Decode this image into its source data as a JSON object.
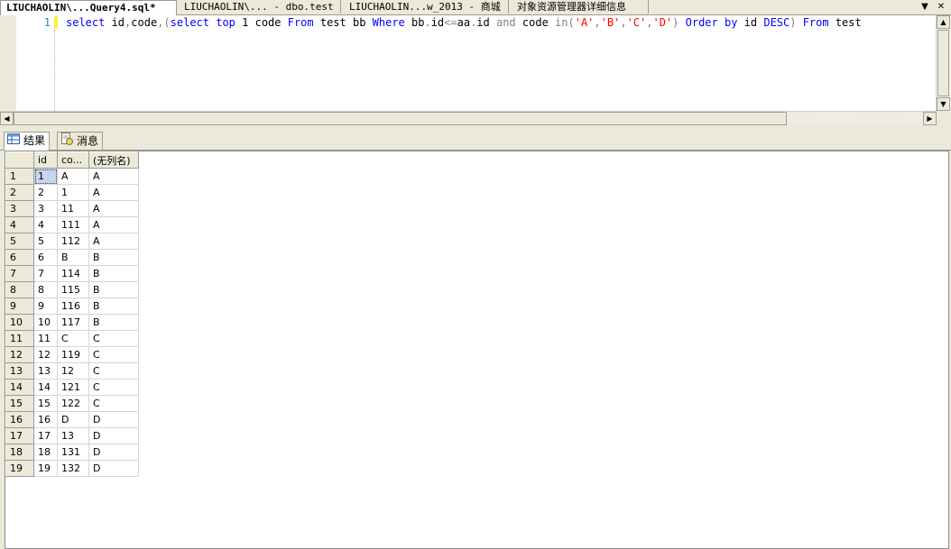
{
  "doc_tabs": [
    {
      "label": "LIUCHAOLIN\\...Query4.sql*",
      "active": true
    },
    {
      "label": "LIUCHAOLIN\\... - dbo.test",
      "active": false
    },
    {
      "label": "LIUCHAOLIN...w_2013 - 商城",
      "active": false
    },
    {
      "label": "对象资源管理器详细信息",
      "active": false
    }
  ],
  "tab_controls": {
    "dropdown": "▼",
    "close": "✕"
  },
  "editor": {
    "line_number": "1",
    "tokens": [
      {
        "t": "select",
        "c": "kw"
      },
      {
        "t": " id",
        "c": "id"
      },
      {
        "t": ",",
        "c": "gr"
      },
      {
        "t": "code",
        "c": "id"
      },
      {
        "t": ",(",
        "c": "gr"
      },
      {
        "t": "select",
        "c": "kw"
      },
      {
        "t": " ",
        "c": "id"
      },
      {
        "t": "top",
        "c": "kw"
      },
      {
        "t": " 1 code ",
        "c": "id"
      },
      {
        "t": "From",
        "c": "kw"
      },
      {
        "t": " test bb ",
        "c": "id"
      },
      {
        "t": "Where",
        "c": "kw"
      },
      {
        "t": " bb",
        "c": "id"
      },
      {
        "t": ".",
        "c": "gr"
      },
      {
        "t": "id",
        "c": "id"
      },
      {
        "t": "<=",
        "c": "gr"
      },
      {
        "t": "aa",
        "c": "id"
      },
      {
        "t": ".",
        "c": "gr"
      },
      {
        "t": "id ",
        "c": "id"
      },
      {
        "t": "and",
        "c": "gr"
      },
      {
        "t": " code ",
        "c": "id"
      },
      {
        "t": "in",
        "c": "gr"
      },
      {
        "t": "(",
        "c": "gr"
      },
      {
        "t": "'A'",
        "c": "str"
      },
      {
        "t": ",",
        "c": "gr"
      },
      {
        "t": "'B'",
        "c": "str"
      },
      {
        "t": ",",
        "c": "gr"
      },
      {
        "t": "'C'",
        "c": "str"
      },
      {
        "t": ",",
        "c": "gr"
      },
      {
        "t": "'D'",
        "c": "str"
      },
      {
        "t": ") ",
        "c": "gr"
      },
      {
        "t": "Order",
        "c": "kw"
      },
      {
        "t": " ",
        "c": "id"
      },
      {
        "t": "by",
        "c": "kw"
      },
      {
        "t": " id ",
        "c": "id"
      },
      {
        "t": "DESC",
        "c": "kw"
      },
      {
        "t": ") ",
        "c": "gr"
      },
      {
        "t": "From",
        "c": "kw"
      },
      {
        "t": " test",
        "c": "id"
      }
    ]
  },
  "result_tabs": {
    "results": "结果",
    "messages": "消息"
  },
  "grid": {
    "columns": [
      "id",
      "co...",
      "(无列名)"
    ],
    "rows": [
      [
        "1",
        "1",
        "A",
        "A"
      ],
      [
        "2",
        "2",
        "1",
        "A"
      ],
      [
        "3",
        "3",
        "11",
        "A"
      ],
      [
        "4",
        "4",
        "111",
        "A"
      ],
      [
        "5",
        "5",
        "112",
        "A"
      ],
      [
        "6",
        "6",
        "B",
        "B"
      ],
      [
        "7",
        "7",
        "114",
        "B"
      ],
      [
        "8",
        "8",
        "115",
        "B"
      ],
      [
        "9",
        "9",
        "116",
        "B"
      ],
      [
        "10",
        "10",
        "117",
        "B"
      ],
      [
        "11",
        "11",
        "C",
        "C"
      ],
      [
        "12",
        "12",
        "119",
        "C"
      ],
      [
        "13",
        "13",
        "12",
        "C"
      ],
      [
        "14",
        "14",
        "121",
        "C"
      ],
      [
        "15",
        "15",
        "122",
        "C"
      ],
      [
        "16",
        "16",
        "D",
        "D"
      ],
      [
        "17",
        "17",
        "13",
        "D"
      ],
      [
        "18",
        "18",
        "131",
        "D"
      ],
      [
        "19",
        "19",
        "132",
        "D"
      ]
    ],
    "selected_cell": {
      "row": 0,
      "col": 1
    }
  },
  "colors": {
    "keyword": "#0000ff",
    "string": "#ff0000",
    "operator": "#808080",
    "line_number": "#2b91af"
  }
}
